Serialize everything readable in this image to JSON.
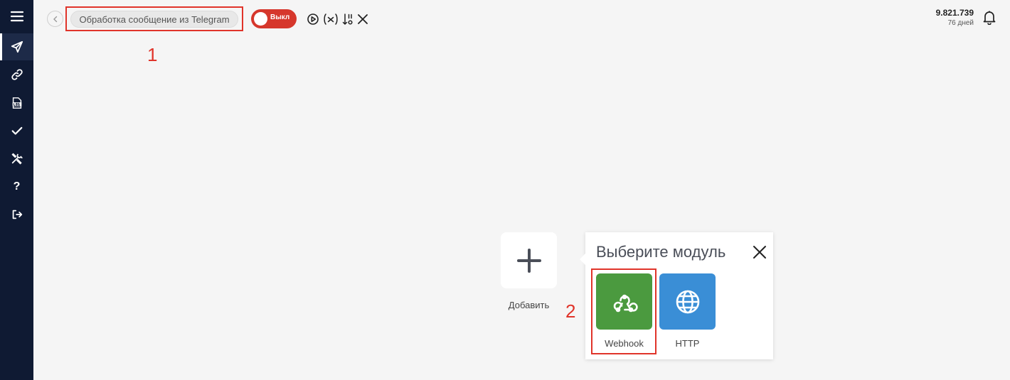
{
  "colors": {
    "sidebar_bg": "#0f1a33",
    "toggle_off": "#d6372c",
    "webhook_bg": "#4b9a3f",
    "http_bg": "#3a8ed6",
    "annotation": "#e0342a"
  },
  "sidebar": {
    "items": [
      {
        "name": "menu",
        "icon": "hamburger-icon"
      },
      {
        "name": "scenarios",
        "icon": "send-icon",
        "active": true
      },
      {
        "name": "connections",
        "icon": "link-icon"
      },
      {
        "name": "logs",
        "icon": "log-icon"
      },
      {
        "name": "tasks",
        "icon": "check-icon"
      },
      {
        "name": "tools",
        "icon": "tools-icon"
      },
      {
        "name": "help",
        "icon": "question-icon",
        "label": "?"
      },
      {
        "name": "logout",
        "icon": "logout-icon"
      }
    ]
  },
  "header": {
    "scenario_title": "Обработка сообщение из Telegram",
    "toggle_label": "Выкл",
    "balance": "9.821.739",
    "days_left": "76 дней"
  },
  "annotations": {
    "marker_1": "1",
    "marker_2": "2"
  },
  "canvas": {
    "add_label": "Добавить"
  },
  "module_picker": {
    "title": "Выберите модуль",
    "modules": [
      {
        "label": "Webhook",
        "icon": "webhook-icon"
      },
      {
        "label": "HTTP",
        "icon": "globe-icon"
      }
    ]
  }
}
